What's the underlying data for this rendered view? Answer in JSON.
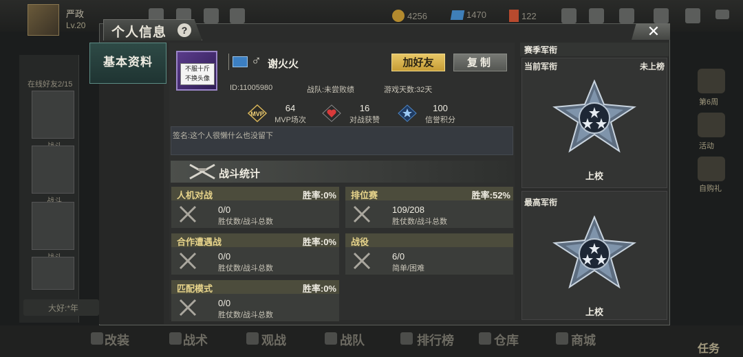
{
  "hud": {
    "player_name": "严政",
    "level": "Lv.20",
    "coins": "4256",
    "diamonds": "1470",
    "tickets": "122",
    "friends_online": "在线好友2/15",
    "side_tag_1": "战斗",
    "side_tag_2": "战斗",
    "side_tag_3": "战斗",
    "chat_text": "大好:*年",
    "right_labels": [
      "第6周",
      "活动",
      "自购礼"
    ],
    "bottom_nav": [
      "改装",
      "战术",
      "观战",
      "战队",
      "排行榜",
      "仓库",
      "商城",
      "任务"
    ]
  },
  "dialog": {
    "title": "个人信息",
    "help": "?",
    "close": "✕",
    "side_tab": "基本资料"
  },
  "profile": {
    "title_badge_line1": "不服十斤",
    "title_badge_line2": "不换头像",
    "gender": "♂",
    "name": "谢火火",
    "add_friend": "加好友",
    "copy": "复制",
    "id": "ID:11005980",
    "team": "战队:未尝败绩",
    "days": "游戏天数:32天",
    "stats": [
      {
        "value": "64",
        "label": "MVP场次"
      },
      {
        "value": "16",
        "label": "对战获赞"
      },
      {
        "value": "100",
        "label": "信誉积分"
      }
    ],
    "mvp_badge": "MVP",
    "signature": "签名:这个人很懒什么也没留下"
  },
  "battle": {
    "title": "战斗统计",
    "cards": [
      {
        "mode": "人机对战",
        "rate": "胜率:0%",
        "value": "0/0",
        "label": "胜仗数/战斗总数"
      },
      {
        "mode": "排位赛",
        "rate": "胜率:52%",
        "value": "109/208",
        "label": "胜仗数/战斗总数"
      },
      {
        "mode": "合作遭遇战",
        "rate": "胜率:0%",
        "value": "0/0",
        "label": "胜仗数/战斗总数"
      },
      {
        "mode": "战役",
        "rate": "",
        "value": "6/0",
        "label": "简单/困难"
      },
      {
        "mode": "匹配模式",
        "rate": "胜率:0%",
        "value": "0/0",
        "label": "胜仗数/战斗总数"
      }
    ]
  },
  "rank": {
    "header": "赛季军衔",
    "current_label": "当前军衔",
    "current_status": "未上榜",
    "current_rank": "上校",
    "highest_label": "最高军衔",
    "highest_rank": "上校"
  },
  "colors": {
    "accent_gold": "#e8c766",
    "tab_teal": "#2e4a46",
    "mode_label": "#e7d48b"
  }
}
